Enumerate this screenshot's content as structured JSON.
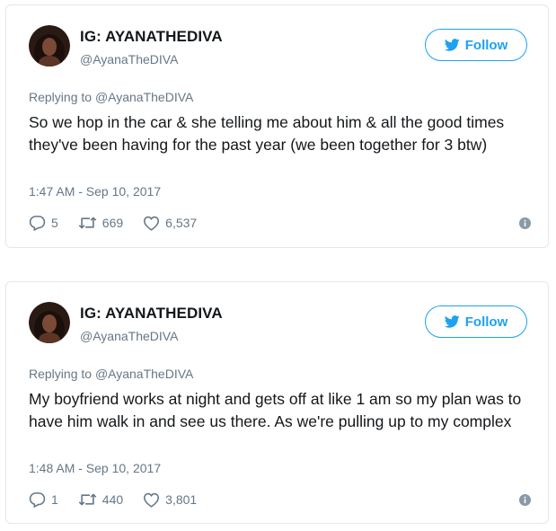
{
  "tweets": [
    {
      "display_name": "IG: AYANATHEDIVA",
      "handle": "@AyanaTheDIVA",
      "follow_label": "Follow",
      "replying_prefix": "Replying to",
      "replying_handle": "@AyanaTheDIVA",
      "text": "So we hop in the car & she telling me about him & all the good times they've been having for the past year (we been together for 3 btw)",
      "timestamp": "1:47 AM - Sep 10, 2017",
      "replies": "5",
      "retweets": "669",
      "likes": "6,537"
    },
    {
      "display_name": "IG: AYANATHEDIVA",
      "handle": "@AyanaTheDIVA",
      "follow_label": "Follow",
      "replying_prefix": "Replying to",
      "replying_handle": "@AyanaTheDIVA",
      "text": "My boyfriend works at night and gets off at like 1 am so my plan was to have him walk in and see us there. As we're pulling up to my complex",
      "timestamp": "1:48 AM - Sep 10, 2017",
      "replies": "1",
      "retweets": "440",
      "likes": "3,801"
    }
  ],
  "icons": {
    "follow": "twitter-bird-icon",
    "reply": "reply-icon",
    "retweet": "retweet-icon",
    "like": "heart-icon",
    "info": "info-icon"
  },
  "colors": {
    "accent": "#1da1f2",
    "muted": "#657786",
    "text": "#14171a",
    "border": "#e1e8ed"
  }
}
